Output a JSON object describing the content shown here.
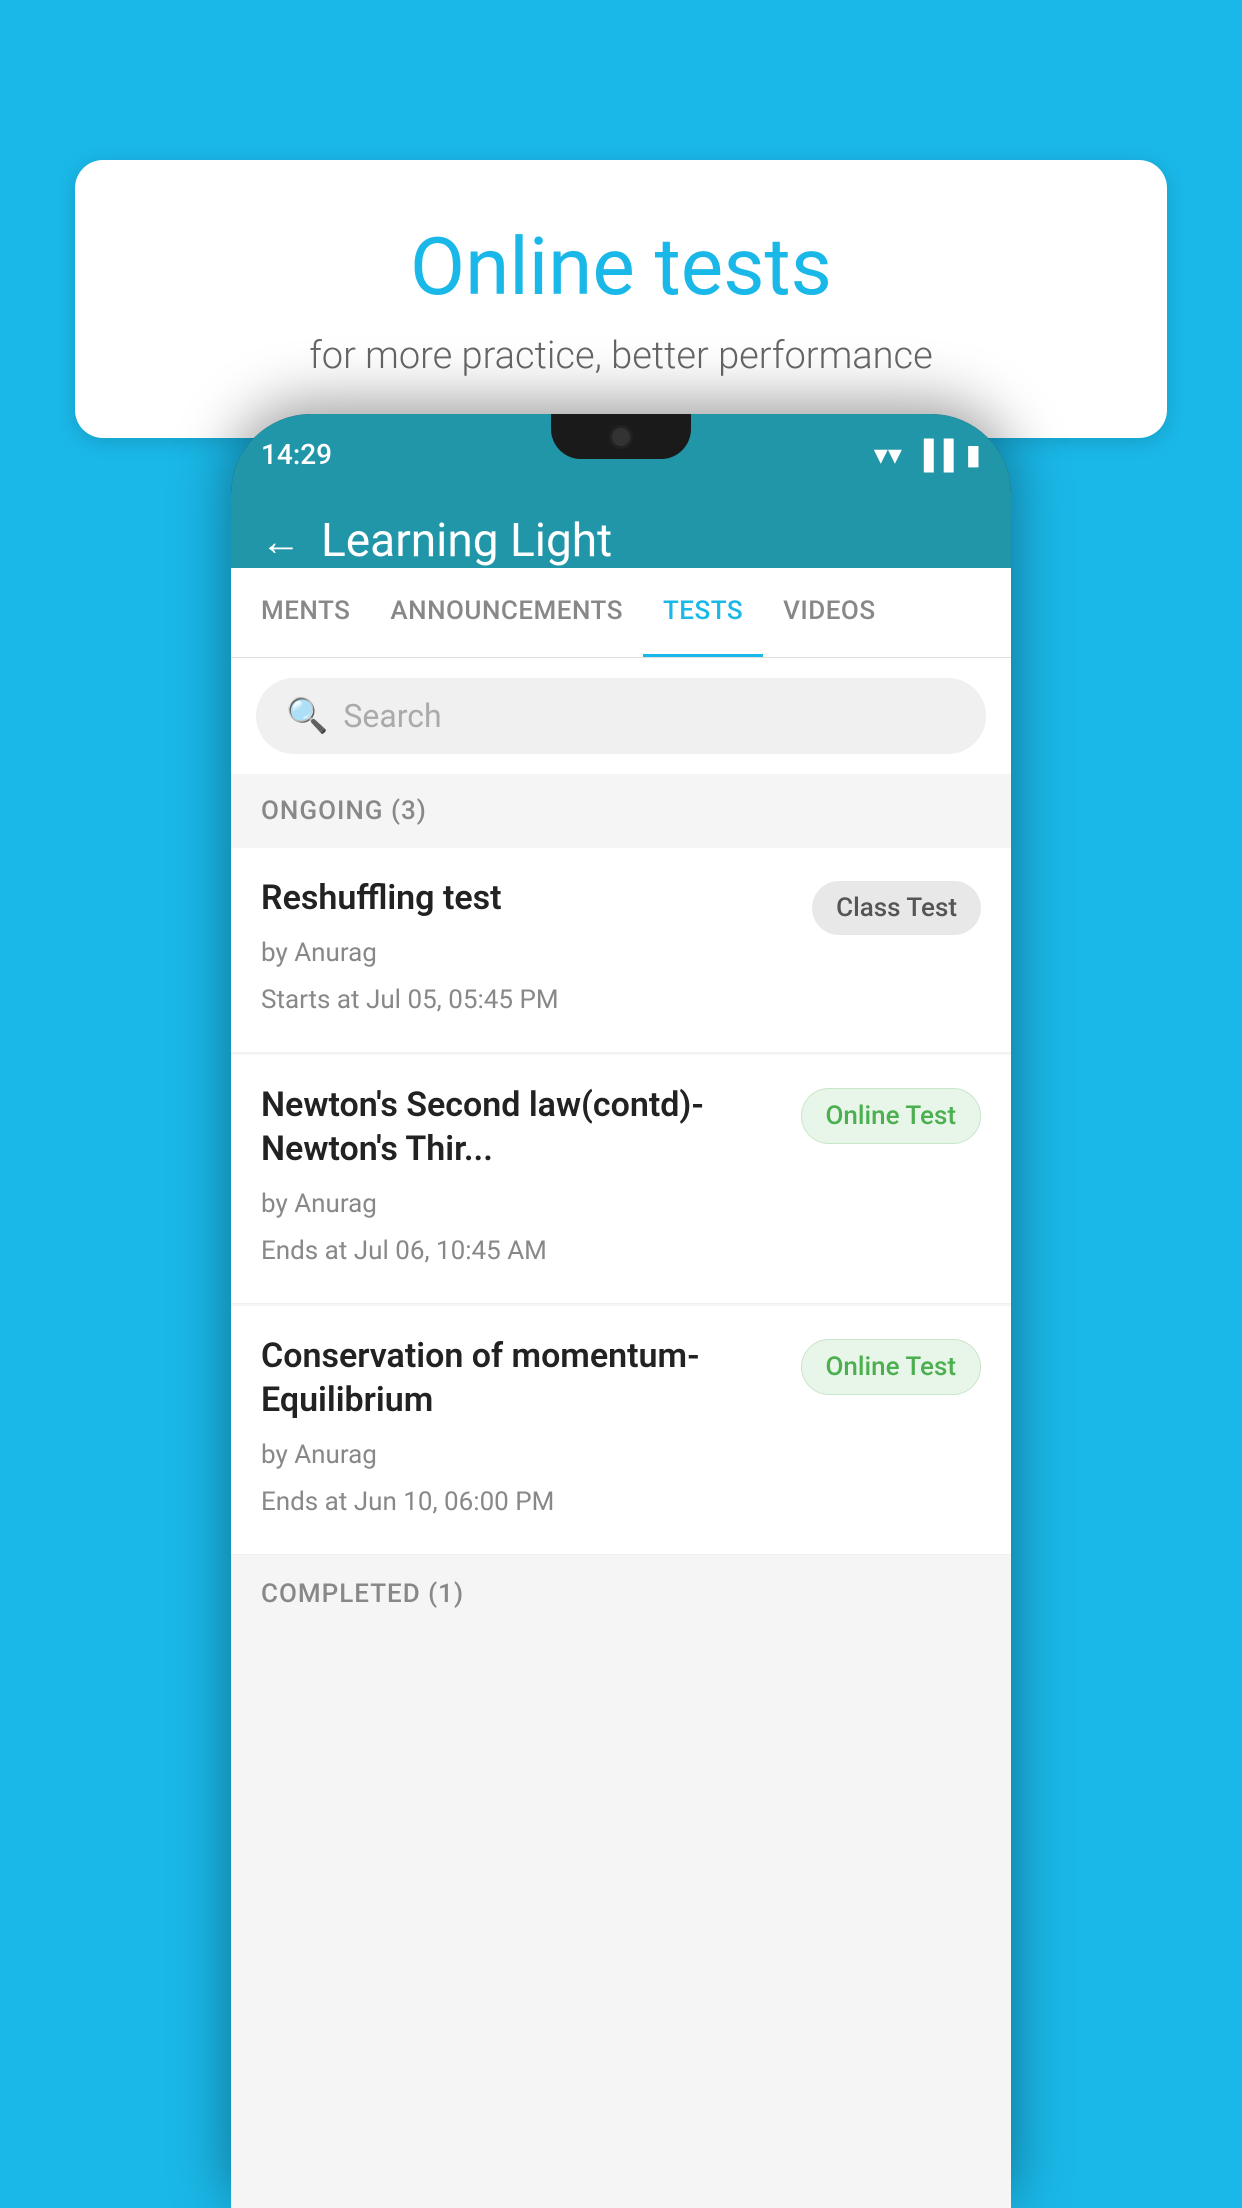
{
  "background_color": "#1ab8e8",
  "speech_bubble": {
    "title": "Online tests",
    "subtitle": "for more practice, better performance"
  },
  "phone": {
    "status_bar": {
      "time": "14:29",
      "wifi_icon": "▼",
      "signal_icon": "▲",
      "battery_icon": "▐"
    },
    "app_header": {
      "back_label": "←",
      "title": "Learning Light"
    },
    "tabs": [
      {
        "label": "MENTS",
        "active": false
      },
      {
        "label": "ANNOUNCEMENTS",
        "active": false
      },
      {
        "label": "TESTS",
        "active": true
      },
      {
        "label": "VIDEOS",
        "active": false
      }
    ],
    "search": {
      "placeholder": "Search"
    },
    "section_ongoing": {
      "label": "ONGOING (3)"
    },
    "tests": [
      {
        "title": "Reshuffling test",
        "by": "by Anurag",
        "date": "Starts at  Jul 05, 05:45 PM",
        "badge": "Class Test",
        "badge_type": "class"
      },
      {
        "title": "Newton's Second law(contd)-Newton's Thir...",
        "by": "by Anurag",
        "date": "Ends at  Jul 06, 10:45 AM",
        "badge": "Online Test",
        "badge_type": "online"
      },
      {
        "title": "Conservation of momentum-Equilibrium",
        "by": "by Anurag",
        "date": "Ends at  Jun 10, 06:00 PM",
        "badge": "Online Test",
        "badge_type": "online"
      }
    ],
    "section_completed": {
      "label": "COMPLETED (1)"
    }
  }
}
